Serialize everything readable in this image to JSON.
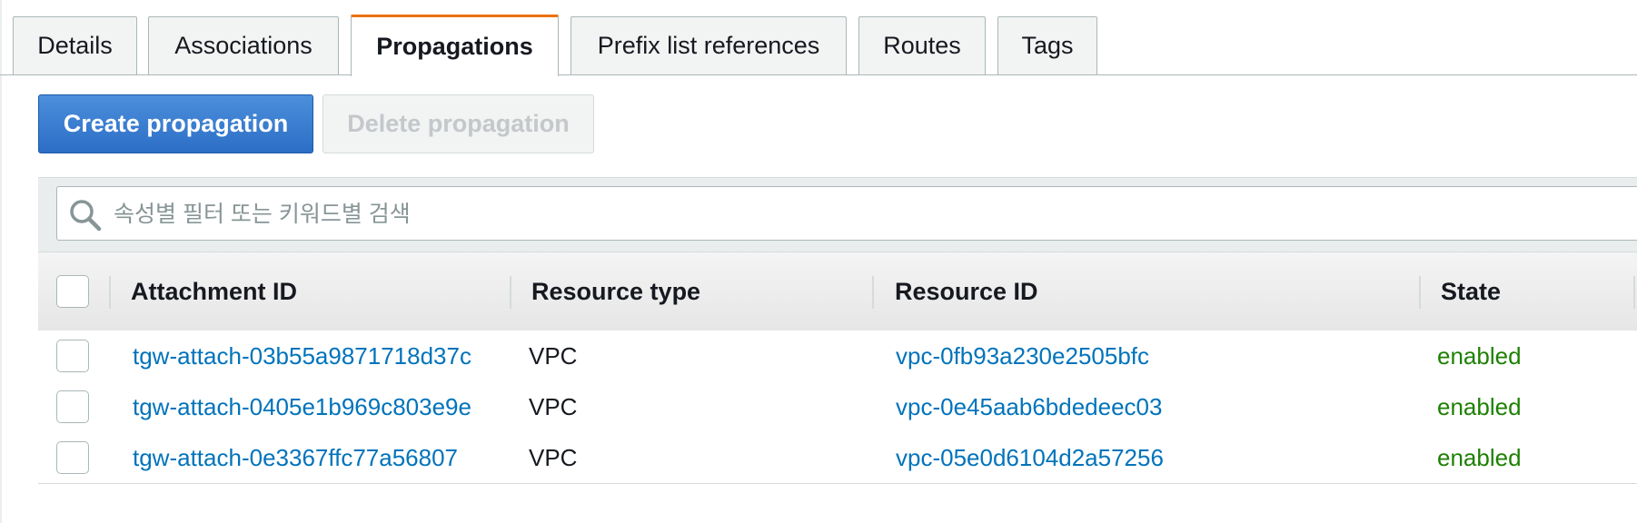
{
  "tabs": [
    {
      "label": "Details"
    },
    {
      "label": "Associations"
    },
    {
      "label": "Propagations",
      "active": true
    },
    {
      "label": "Prefix list references"
    },
    {
      "label": "Routes"
    },
    {
      "label": "Tags"
    }
  ],
  "actions": {
    "create_label": "Create propagation",
    "delete_label": "Delete propagation"
  },
  "search": {
    "placeholder": "속성별 필터 또는 키워드별 검색",
    "value": ""
  },
  "table": {
    "columns": [
      "Attachment ID",
      "Resource type",
      "Resource ID",
      "State"
    ],
    "rows": [
      {
        "attachment_id": "tgw-attach-03b55a9871718d37c",
        "resource_type": "VPC",
        "resource_id": "vpc-0fb93a230e2505bfc",
        "state": "enabled"
      },
      {
        "attachment_id": "tgw-attach-0405e1b969c803e9e",
        "resource_type": "VPC",
        "resource_id": "vpc-0e45aab6bdedeec03",
        "state": "enabled"
      },
      {
        "attachment_id": "tgw-attach-0e3367ffc77a56807",
        "resource_type": "VPC",
        "resource_id": "vpc-05e0d6104d2a57256",
        "state": "enabled"
      }
    ]
  },
  "colors": {
    "accent_tab": "#ec7211",
    "primary_button": "#2c6ec6",
    "link": "#0073bb",
    "status_enabled": "#1d8102"
  },
  "icons": {
    "search": "search-icon"
  }
}
